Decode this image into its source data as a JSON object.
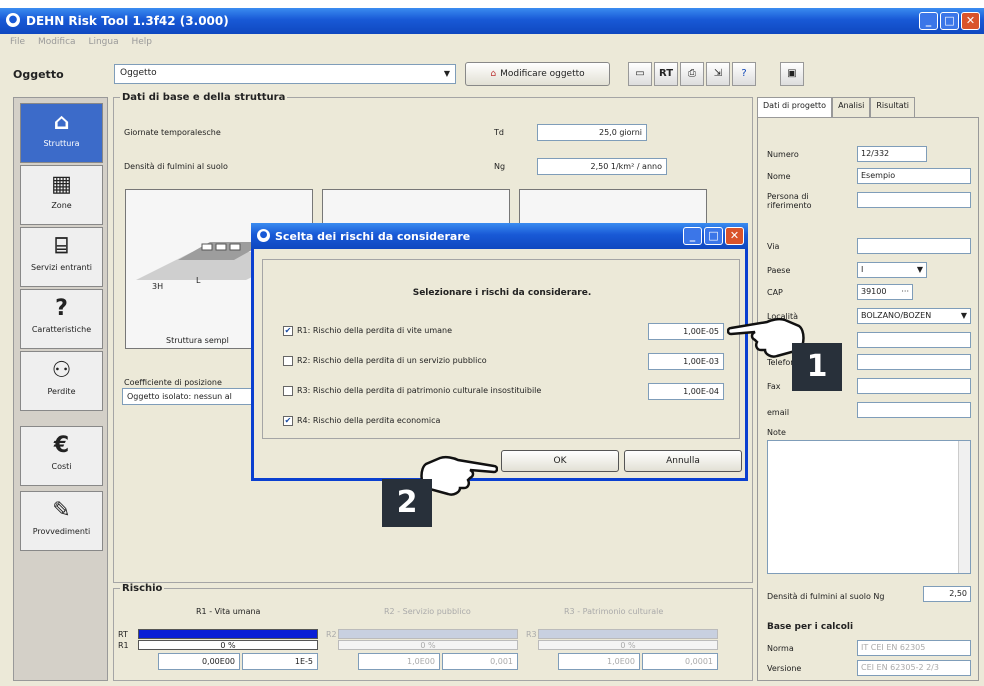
{
  "window": {
    "title": "DEHN Risk Tool 1.3f42 (3.000)"
  },
  "menu": [
    "File",
    "Modifica",
    "Lingua",
    "Help"
  ],
  "toolbar": {
    "object_label": "Oggetto",
    "object_combo": "Oggetto",
    "modify_button": "Modificare oggetto",
    "rt_label": "RT"
  },
  "sidebar": [
    {
      "label": "Struttura",
      "icon": "house-icon"
    },
    {
      "label": "Zone",
      "icon": "zone-icon"
    },
    {
      "label": "Servizi entranti",
      "icon": "services-icon"
    },
    {
      "label": "Caratteristiche",
      "icon": "question-icon"
    },
    {
      "label": "Perdite",
      "icon": "people-icon"
    },
    {
      "label": "Costi",
      "icon": "euro-icon"
    },
    {
      "label": "Provvedimenti",
      "icon": "wrench-icon"
    }
  ],
  "main": {
    "group_title": "Dati di base e della struttura",
    "thunder_days_label": "Giornate temporalesche",
    "thunder_days_sym": "Td",
    "thunder_days_value": "25,0 giorni",
    "density_label": "Densità di fulmini al suolo",
    "density_sym": "Ng",
    "density_value": "2,50 1/km² / anno",
    "card_caption": "Struttura sempl",
    "card_labels": [
      "3H",
      "L"
    ],
    "position_label": "Coefficiente di posizione",
    "position_value": "Oggetto isolato: nessun al"
  },
  "rischio": {
    "title": "Rischio",
    "columns": [
      "R1 - Vita umana",
      "R2 - Servizio pubblico",
      "R3 - Patrimonio culturale"
    ],
    "row_labels": [
      "RT",
      "R1",
      "R2",
      "R3"
    ],
    "r1_percent": "0 %",
    "r1_value": "0,00E00",
    "r1_limit": "1E-5",
    "r2_percent": "0 %",
    "r2_value": "1,0E00",
    "r2_limit": "0,001",
    "r3_percent": "0 %",
    "r3_value": "1,0E00",
    "r3_limit": "0,0001",
    "bar_color": "#0a1ed6"
  },
  "right": {
    "tabs": [
      "Dati di progetto",
      "Analisi",
      "Risultati"
    ],
    "fields": [
      {
        "label": "Numero",
        "value": "12/332"
      },
      {
        "label": "Nome",
        "value": "Esempio"
      },
      {
        "label": "Persona di riferimento",
        "value": ""
      },
      {
        "label": "Via",
        "value": ""
      },
      {
        "label": "Paese",
        "value": "I"
      },
      {
        "label": "CAP",
        "value": "39100"
      },
      {
        "label": "Località",
        "value": "BOLZANO/BOZEN"
      },
      {
        "label": "",
        "value": ""
      },
      {
        "label": "Telefono",
        "value": ""
      },
      {
        "label": "Fax",
        "value": ""
      },
      {
        "label": "email",
        "value": ""
      }
    ],
    "note_label": "Note",
    "density_label": "Densità di fulmini al suolo Ng",
    "density_value": "2,50",
    "base_title": "Base per i calcoli",
    "norma_label": "Norma",
    "norma_value": "IT CEI EN 62305",
    "versione_label": "Versione",
    "versione_value": "CEI EN 62305-2 2/3"
  },
  "dialog": {
    "title": "Scelta dei rischi da considerare",
    "heading": "Selezionare i rischi da considerare.",
    "risks": [
      {
        "label": "R1: Rischio della perdita di vite umane",
        "checked": true,
        "value": "1,00E-05"
      },
      {
        "label": "R2: Rischio della perdita di un servizio pubblico",
        "checked": false,
        "value": "1,00E-03"
      },
      {
        "label": "R3: Rischio della perdita di patrimonio culturale insostituibile",
        "checked": false,
        "value": "1,00E-04"
      },
      {
        "label": "R4: Rischio della perdita economica",
        "checked": true,
        "value": ""
      }
    ],
    "ok_label": "OK",
    "cancel_label": "Annulla"
  },
  "callouts": {
    "one": "1",
    "two": "2"
  },
  "colors": {
    "accent": "#1859d6",
    "badge": "#28303a"
  }
}
